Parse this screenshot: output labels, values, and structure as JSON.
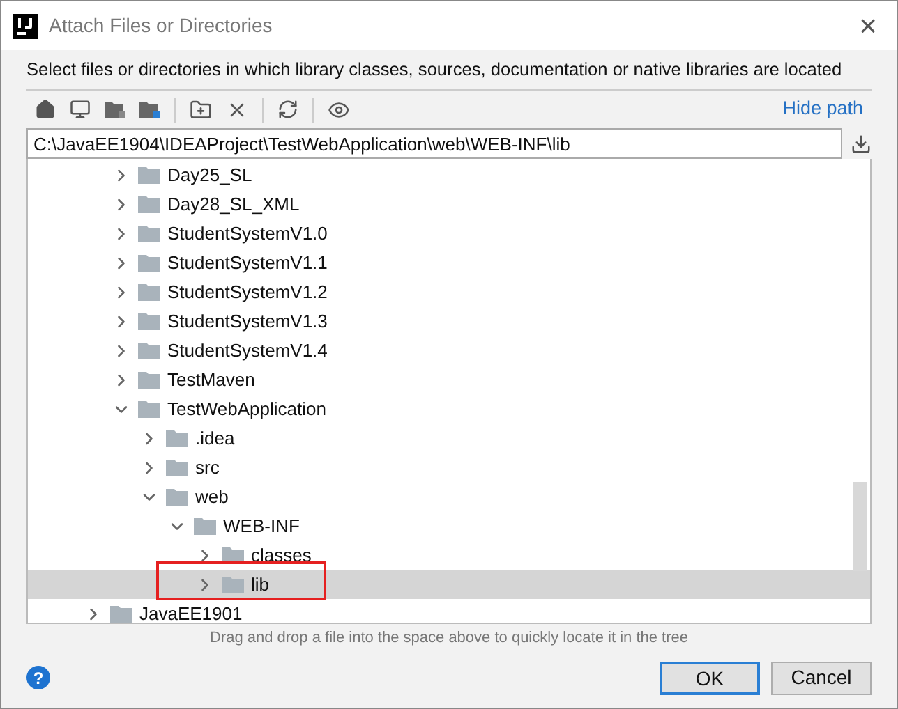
{
  "window": {
    "title": "Attach Files or Directories",
    "close": "×"
  },
  "description": "Select files or directories in which library classes, sources, documentation or native libraries are located",
  "toolbar": {
    "hide_path": "Hide path"
  },
  "path": {
    "value": "C:\\JavaEE1904\\IDEAProject\\TestWebApplication\\web\\WEB-INF\\lib"
  },
  "tree": {
    "partial_branch": [
      {
        "label": "Day25_SL",
        "expanded": false,
        "selected": false,
        "highlighted": false
      },
      {
        "label": "Day28_SL_XML",
        "expanded": false,
        "selected": false,
        "highlighted": false
      },
      {
        "label": "StudentSystemV1.0",
        "expanded": false,
        "selected": false,
        "highlighted": false
      },
      {
        "label": "StudentSystemV1.1",
        "expanded": false,
        "selected": false,
        "highlighted": false
      },
      {
        "label": "StudentSystemV1.2",
        "expanded": false,
        "selected": false,
        "highlighted": false
      },
      {
        "label": "StudentSystemV1.3",
        "expanded": false,
        "selected": false,
        "highlighted": false
      },
      {
        "label": "StudentSystemV1.4",
        "expanded": false,
        "selected": false,
        "highlighted": false
      },
      {
        "label": "TestMaven",
        "expanded": false,
        "selected": false,
        "highlighted": false
      },
      {
        "label": "TestWebApplication",
        "expanded": true,
        "selected": false,
        "highlighted": false,
        "children": [
          {
            "label": ".idea",
            "expanded": false,
            "selected": false,
            "highlighted": false
          },
          {
            "label": "src",
            "expanded": false,
            "selected": false,
            "highlighted": false
          },
          {
            "label": "web",
            "expanded": true,
            "selected": false,
            "highlighted": false,
            "children": [
              {
                "label": "WEB-INF",
                "expanded": true,
                "selected": false,
                "highlighted": false,
                "children": [
                  {
                    "label": "classes",
                    "expanded": false,
                    "selected": false,
                    "highlighted": false
                  },
                  {
                    "label": "lib",
                    "expanded": false,
                    "selected": true,
                    "highlighted": true
                  }
                ]
              }
            ]
          }
        ]
      }
    ],
    "items": [
      {
        "label": "JavaEE1901",
        "expanded": false,
        "selected": false,
        "highlighted": false
      }
    ]
  },
  "hint": "Drag and drop a file into the space above to quickly locate it in the tree",
  "help": "?",
  "buttons": [
    {
      "label": "OK",
      "default": true
    },
    {
      "label": "Cancel",
      "default": false
    }
  ]
}
